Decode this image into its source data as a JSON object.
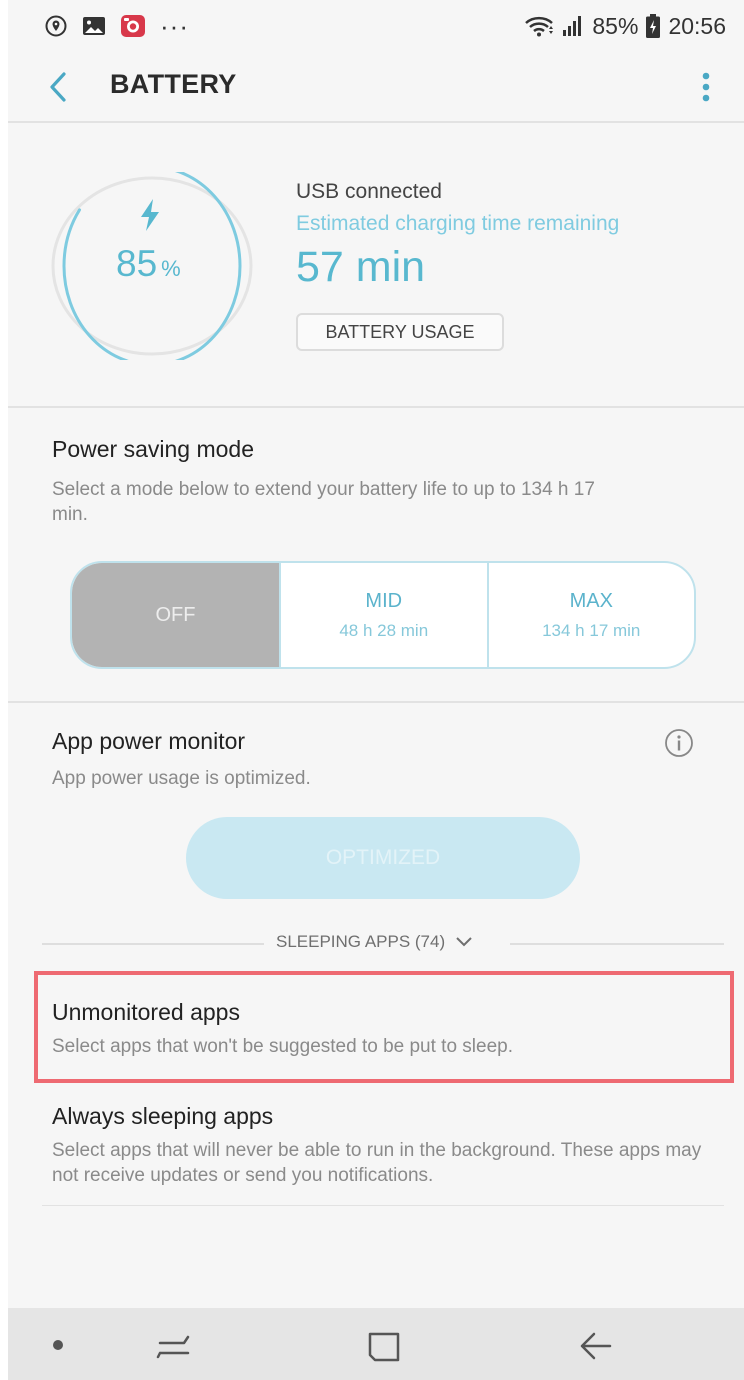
{
  "status_bar": {
    "battery_percent": "85%",
    "time": "20:56",
    "icons": [
      "location-icon",
      "image-icon",
      "camera-app-icon",
      "more-notifications-icon",
      "wifi-icon",
      "signal-icon",
      "battery-charging-icon"
    ],
    "more_dots": "···"
  },
  "header": {
    "title": "BATTERY",
    "icons": [
      "back-arrow-icon",
      "overflow-menu-icon"
    ]
  },
  "battery": {
    "level_percent": 85,
    "level_value": "85",
    "level_unit": "%",
    "connection": "USB connected",
    "estimate_label": "Estimated charging time remaining",
    "time_remaining": "57 min",
    "usage_button": "BATTERY USAGE",
    "accent_color": "#58b8cf"
  },
  "power_saving": {
    "title": "Power saving mode",
    "description": "Select a mode below to extend your battery life to up to 134 h 17 min.",
    "modes": [
      {
        "name": "OFF",
        "time": "",
        "selected": true
      },
      {
        "name": "MID",
        "time": "48 h 28 min",
        "selected": false
      },
      {
        "name": "MAX",
        "time": "134 h 17 min",
        "selected": false
      }
    ]
  },
  "app_power_monitor": {
    "title": "App power monitor",
    "description": "App power usage is optimized.",
    "button": "OPTIMIZED",
    "sleeping_apps": "SLEEPING APPS (74)"
  },
  "list": [
    {
      "title": "Unmonitored apps",
      "description": "Select apps that won't be suggested to be put to sleep."
    },
    {
      "title": "Always sleeping apps",
      "description": "Select apps that will never be able to run in the background. These apps may not receive updates or send you notifications."
    }
  ],
  "nav": {
    "icons": [
      "dot-icon",
      "recent-apps-icon",
      "home-icon",
      "back-icon"
    ]
  },
  "colors": {
    "accent": "#58b8cf",
    "highlight": "#ee6a72"
  }
}
